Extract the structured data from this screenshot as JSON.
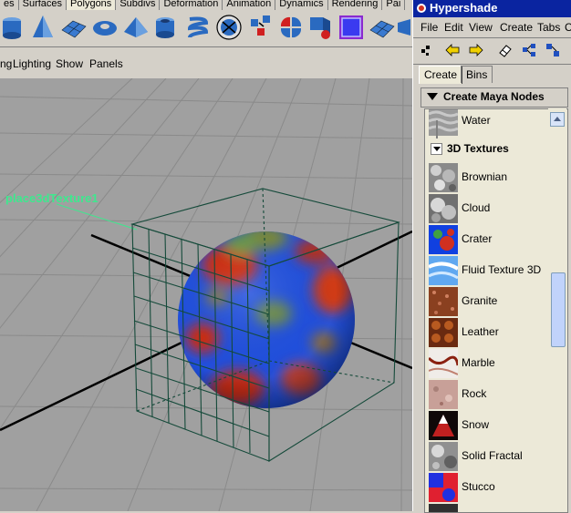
{
  "shelf": {
    "tabs": [
      "es",
      "Surfaces",
      "Polygons",
      "Subdivs",
      "Deformation",
      "Animation",
      "Dynamics",
      "Rendering",
      "Pai"
    ],
    "active_tab_index": 2
  },
  "panel_menu": [
    "ng",
    "Lighting",
    "Show",
    "Panels"
  ],
  "viewport": {
    "annotation": "place3dTexture1"
  },
  "hypershade": {
    "title": "Hypershade",
    "menus": [
      "File",
      "Edit",
      "View",
      "Create",
      "Tabs",
      "C"
    ],
    "tabs": [
      "Create",
      "Bins"
    ],
    "active_tab_index": 0,
    "section_header": "Create Maya Nodes",
    "first_node": "Water",
    "subsection": "3D Textures",
    "nodes": [
      "Brownian",
      "Cloud",
      "Crater",
      "Fluid Texture 3D",
      "Granite",
      "Leather",
      "Marble",
      "Rock",
      "Snow",
      "Solid Fractal",
      "Stucco"
    ]
  },
  "colors": {
    "title_bar": "#0a24a0",
    "panel_bg": "#d4d0c8",
    "list_bg": "#ece9d8",
    "annotation": "#3ee88e"
  }
}
